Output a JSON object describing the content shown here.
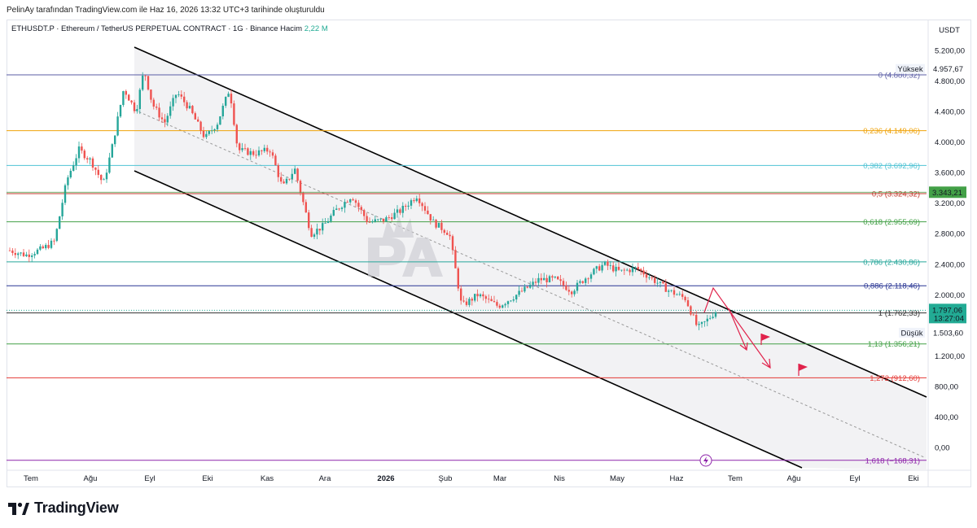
{
  "credit": "PelinAy tarafından TradingView.com ile Haz 16, 2026 13:32 UTC+3 tarihinde oluşturuldu",
  "header": {
    "symbol": "ETHUSDT.P · Ethereum / TetherUS PERPETUAL CONTRACT · 1G · Binance",
    "volume_label": "Hacim",
    "volume_value": "2,22 M"
  },
  "brand": "TradingView",
  "colors": {
    "up": "#26a69a",
    "down": "#ef5350",
    "channel": "#000000",
    "arrow": "#e0224b",
    "price_badge": "#22ab94"
  },
  "chart_data": {
    "type": "candlestick",
    "currency": "USDT",
    "ylim": [
      -240,
      5450
    ],
    "y_ticks": [
      "5.200,00",
      "4.800,00",
      "4.400,00",
      "4.000,00",
      "3.600,00",
      "3.200,00",
      "2.800,00",
      "2.400,00",
      "2.000,00",
      "1.200,00",
      "800,00",
      "400,00",
      "0,00"
    ],
    "y_tick_values": [
      5200,
      4800,
      4400,
      4000,
      3600,
      3200,
      2800,
      2400,
      2000,
      1200,
      800,
      400,
      0
    ],
    "x_ticks": [
      "Tem",
      "Ağu",
      "Eyl",
      "Eki",
      "Kas",
      "Ara",
      "2026",
      "Şub",
      "Mar",
      "Nis",
      "May",
      "Haz",
      "Tem",
      "Ağu",
      "Eyl",
      "Eki"
    ],
    "price_path": [
      [
        0,
        2580
      ],
      [
        20,
        2520
      ],
      [
        40,
        2600
      ],
      [
        55,
        2700
      ],
      [
        70,
        3500
      ],
      [
        85,
        3900
      ],
      [
        100,
        3750
      ],
      [
        115,
        3450
      ],
      [
        125,
        3900
      ],
      [
        140,
        4700
      ],
      [
        155,
        4400
      ],
      [
        165,
        4950
      ],
      [
        175,
        4500
      ],
      [
        190,
        4250
      ],
      [
        205,
        4650
      ],
      [
        220,
        4450
      ],
      [
        240,
        4050
      ],
      [
        255,
        4250
      ],
      [
        270,
        4700
      ],
      [
        280,
        3900
      ],
      [
        300,
        3850
      ],
      [
        320,
        3900
      ],
      [
        335,
        3400
      ],
      [
        350,
        3650
      ],
      [
        370,
        2800
      ],
      [
        385,
        2900
      ],
      [
        400,
        3100
      ],
      [
        420,
        3300
      ],
      [
        440,
        2950
      ],
      [
        460,
        2980
      ],
      [
        480,
        3100
      ],
      [
        500,
        3300
      ],
      [
        520,
        2950
      ],
      [
        540,
        2800
      ],
      [
        555,
        1850
      ],
      [
        575,
        2000
      ],
      [
        600,
        1850
      ],
      [
        630,
        2050
      ],
      [
        650,
        2200
      ],
      [
        670,
        2200
      ],
      [
        690,
        2050
      ],
      [
        710,
        2250
      ],
      [
        730,
        2400
      ],
      [
        750,
        2300
      ],
      [
        770,
        2350
      ],
      [
        790,
        2200
      ],
      [
        810,
        2050
      ],
      [
        830,
        1950
      ],
      [
        845,
        1560
      ],
      [
        855,
        1650
      ],
      [
        868,
        1797
      ]
    ],
    "last_price": "1.797,06",
    "countdown": "13:27:04",
    "high_label": "Yüksek",
    "high_value": "4.957,67",
    "low_label": "Düşük",
    "low_value": "1.503,60",
    "marker_price": "3.343,21",
    "fib_levels": [
      {
        "ratio": "0",
        "label": "0 (4.880,32)",
        "price": 4880,
        "color": "#5b5ea6"
      },
      {
        "ratio": "0.236",
        "label": "0,236 (4.149,06)",
        "price": 4149,
        "color": "#f0a30a"
      },
      {
        "ratio": "0.382",
        "label": "0,382 (3.692,96)",
        "price": 3693,
        "color": "#4fc3d4"
      },
      {
        "ratio": "0.5",
        "label": "0,5 (3.324,32)",
        "price": 3324,
        "color": "#c0392b"
      },
      {
        "ratio": "0.618",
        "label": "0,618 (2.955,69)",
        "price": 2956,
        "color": "#43a047"
      },
      {
        "ratio": "0.786",
        "label": "0,786 (2.430,86)",
        "price": 2431,
        "color": "#26a69a"
      },
      {
        "ratio": "0.886",
        "label": "0,886 (2.118,46)",
        "price": 2118,
        "color": "#283593"
      },
      {
        "ratio": "1",
        "label": "1 (1.762,33)",
        "price": 1762,
        "color": "#333333"
      },
      {
        "ratio": "1.13",
        "label": "1,13 (1.356,21)",
        "price": 1356,
        "color": "#43a047"
      },
      {
        "ratio": "1.272",
        "label": "1,272 (912,60)",
        "price": 912,
        "color": "#e53935"
      },
      {
        "ratio": "1.618",
        "label": "1,618 (−168,31)",
        "price": -168,
        "color": "#8e24aa"
      }
    ]
  }
}
